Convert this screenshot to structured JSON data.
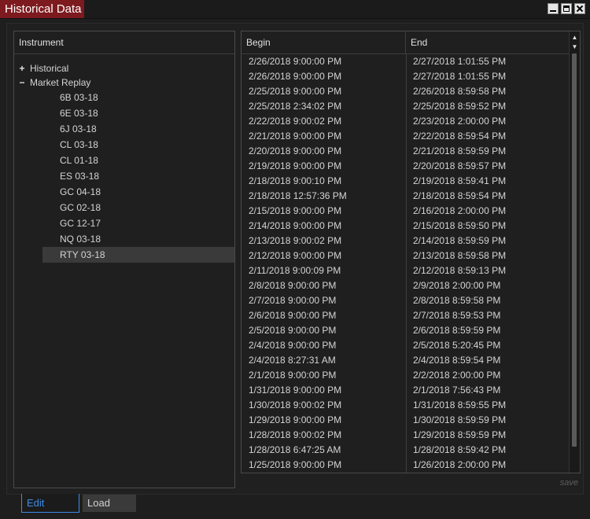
{
  "window": {
    "title": "Historical Data",
    "controls": [
      "minimize-icon",
      "maximize-icon",
      "close-icon"
    ]
  },
  "tree": {
    "header": "Instrument",
    "nodes": [
      {
        "label": "Historical",
        "expanded": false,
        "toggle": "+"
      },
      {
        "label": "Market Replay",
        "expanded": true,
        "toggle": "−"
      }
    ],
    "leaves": [
      "6B 03-18",
      "6E 03-18",
      "6J 03-18",
      "CL 03-18",
      "CL 01-18",
      "ES 03-18",
      "GC 04-18",
      "GC 02-18",
      "GC 12-17",
      "NQ 03-18",
      "RTY 03-18"
    ],
    "selected": "RTY 03-18"
  },
  "grid": {
    "columns": [
      "Begin",
      "End"
    ],
    "rows": [
      [
        "2/26/2018 9:00:00 PM",
        "2/27/2018 1:01:55 PM"
      ],
      [
        "2/26/2018 9:00:00 PM",
        "2/27/2018 1:01:55 PM"
      ],
      [
        "2/25/2018 9:00:00 PM",
        "2/26/2018 8:59:58 PM"
      ],
      [
        "2/25/2018 2:34:02 PM",
        "2/25/2018 8:59:52 PM"
      ],
      [
        "2/22/2018 9:00:02 PM",
        "2/23/2018 2:00:00 PM"
      ],
      [
        "2/21/2018 9:00:00 PM",
        "2/22/2018 8:59:54 PM"
      ],
      [
        "2/20/2018 9:00:00 PM",
        "2/21/2018 8:59:59 PM"
      ],
      [
        "2/19/2018 9:00:00 PM",
        "2/20/2018 8:59:57 PM"
      ],
      [
        "2/18/2018 9:00:10 PM",
        "2/19/2018 8:59:41 PM"
      ],
      [
        "2/18/2018 12:57:36 PM",
        "2/18/2018 8:59:54 PM"
      ],
      [
        "2/15/2018 9:00:00 PM",
        "2/16/2018 2:00:00 PM"
      ],
      [
        "2/14/2018 9:00:00 PM",
        "2/15/2018 8:59:50 PM"
      ],
      [
        "2/13/2018 9:00:02 PM",
        "2/14/2018 8:59:59 PM"
      ],
      [
        "2/12/2018 9:00:00 PM",
        "2/13/2018 8:59:58 PM"
      ],
      [
        "2/11/2018 9:00:09 PM",
        "2/12/2018 8:59:13 PM"
      ],
      [
        "2/8/2018 9:00:00 PM",
        "2/9/2018 2:00:00 PM"
      ],
      [
        "2/7/2018 9:00:00 PM",
        "2/8/2018 8:59:58 PM"
      ],
      [
        "2/6/2018 9:00:00 PM",
        "2/7/2018 8:59:53 PM"
      ],
      [
        "2/5/2018 9:00:00 PM",
        "2/6/2018 8:59:59 PM"
      ],
      [
        "2/4/2018 9:00:00 PM",
        "2/5/2018 5:20:45 PM"
      ],
      [
        "2/4/2018 8:27:31 AM",
        "2/4/2018 8:59:54 PM"
      ],
      [
        "2/1/2018 9:00:00 PM",
        "2/2/2018 2:00:00 PM"
      ],
      [
        "1/31/2018 9:00:00 PM",
        "2/1/2018 7:56:43 PM"
      ],
      [
        "1/30/2018 9:00:02 PM",
        "1/31/2018 8:59:55 PM"
      ],
      [
        "1/29/2018 9:00:00 PM",
        "1/30/2018 8:59:59 PM"
      ],
      [
        "1/28/2018 9:00:02 PM",
        "1/29/2018 8:59:59 PM"
      ],
      [
        "1/28/2018 6:47:25 AM",
        "1/28/2018 8:59:42 PM"
      ],
      [
        "1/25/2018 9:00:00 PM",
        "1/26/2018 2:00:00 PM"
      ]
    ]
  },
  "save_label": "save",
  "tabs": [
    {
      "label": "Edit",
      "active": true
    },
    {
      "label": "Load",
      "active": false
    }
  ],
  "colors": {
    "title_accent": "#7d1a1f",
    "active_tab": "#3e8ce6"
  }
}
